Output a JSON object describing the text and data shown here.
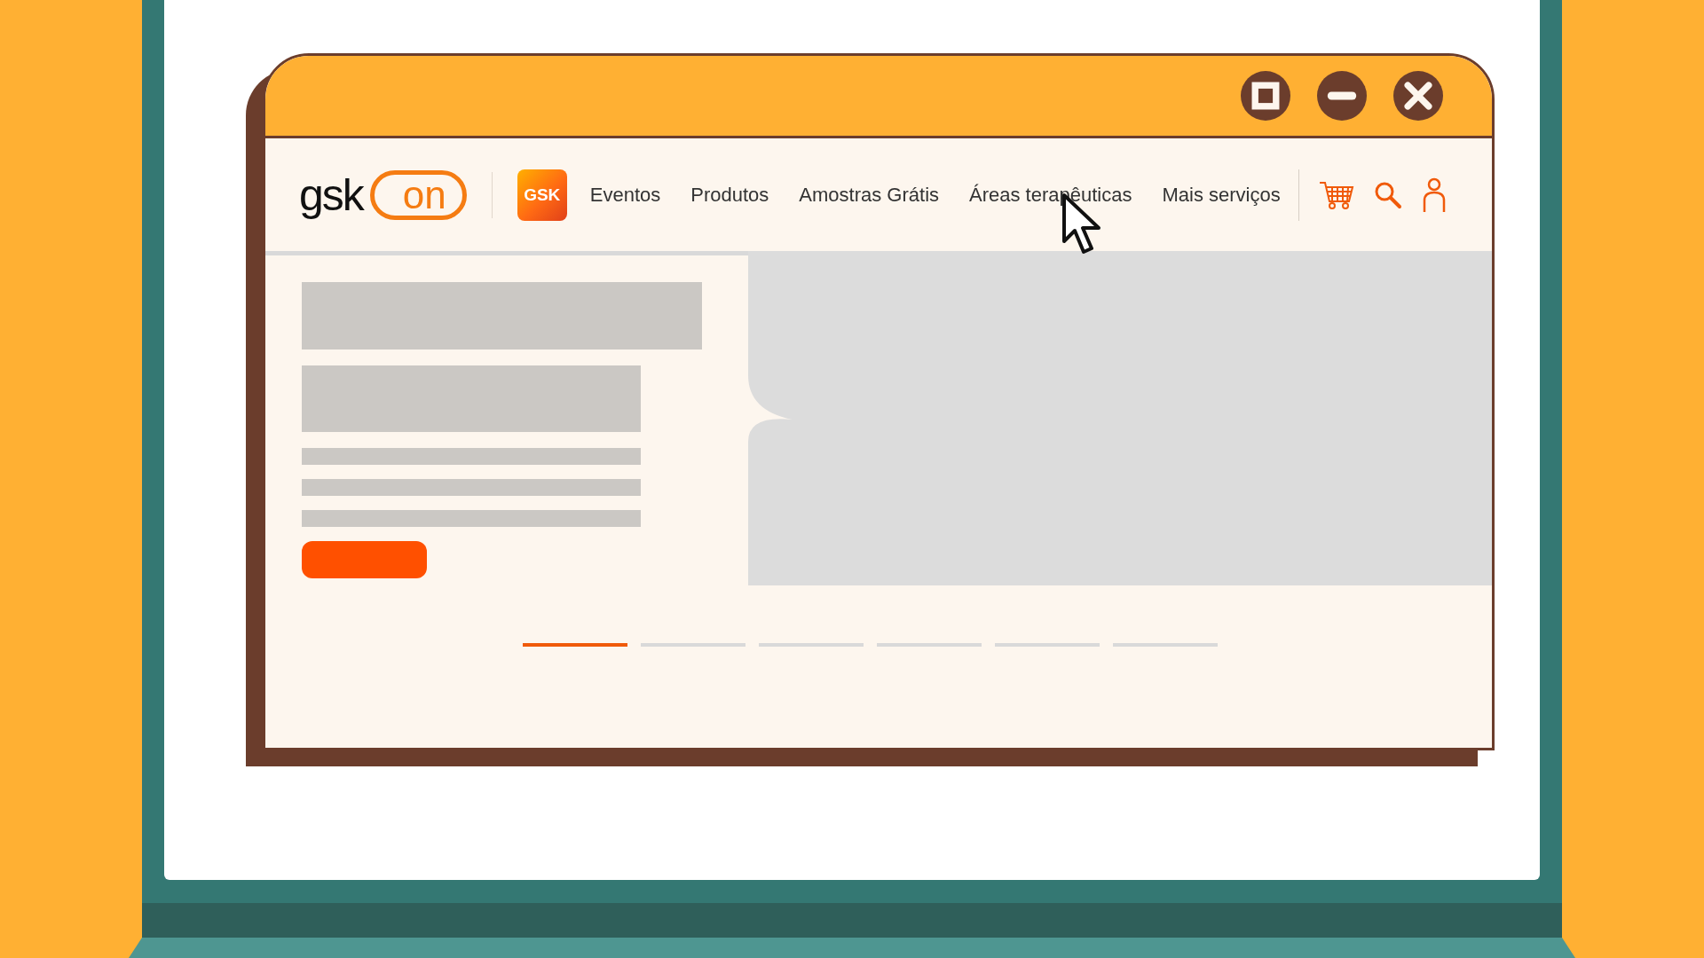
{
  "window": {
    "controls": [
      {
        "kind": "maximize"
      },
      {
        "kind": "minimize"
      },
      {
        "kind": "close"
      }
    ]
  },
  "header": {
    "logo": {
      "word": "gsk",
      "pill": "on"
    },
    "brand_badge": "GSK",
    "nav": [
      "Eventos",
      "Produtos",
      "Amostras Grátis",
      "Áreas terapêuticas",
      "Mais serviços"
    ],
    "actions": [
      {
        "kind": "cart"
      },
      {
        "kind": "search"
      },
      {
        "kind": "account"
      }
    ]
  },
  "carousel": [
    {
      "selected": true
    },
    {
      "selected": false
    },
    {
      "selected": false
    },
    {
      "selected": false
    },
    {
      "selected": false
    },
    {
      "selected": false
    }
  ]
}
